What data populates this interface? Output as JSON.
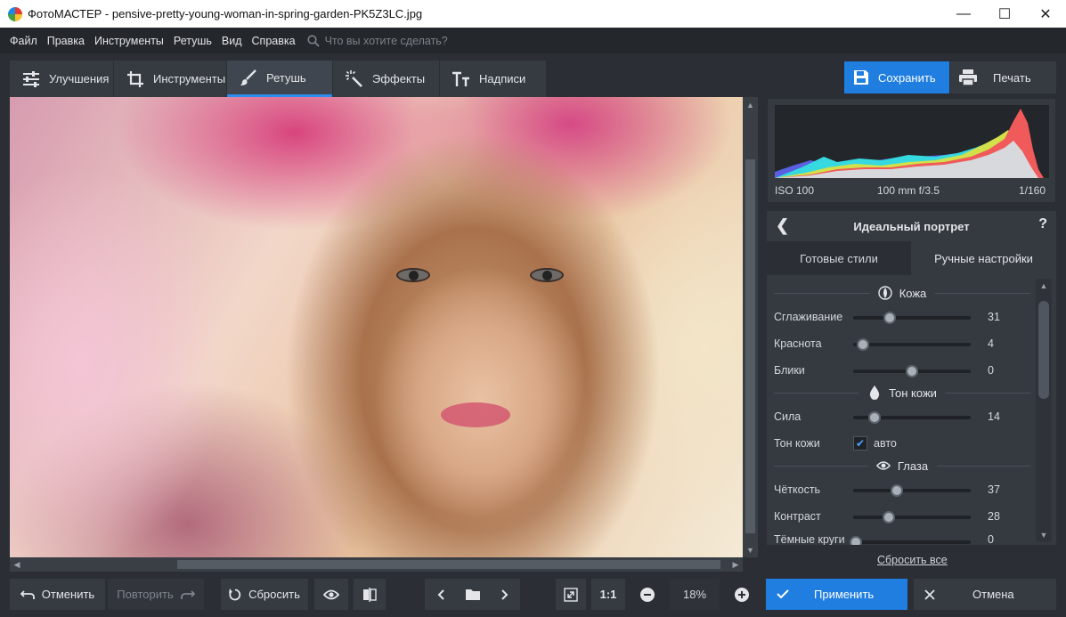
{
  "window": {
    "title": "ФотоМАСТЕР - pensive-pretty-young-woman-in-spring-garden-PK5Z3LC.jpg",
    "minimize_glyph": "—",
    "maximize_glyph": "☐",
    "close_glyph": "✕"
  },
  "menu": {
    "items": [
      "Файл",
      "Правка",
      "Инструменты",
      "Ретушь",
      "Вид",
      "Справка"
    ],
    "search_placeholder": "Что вы хотите сделать?"
  },
  "toolbar": {
    "tabs": [
      {
        "label": "Улучшения",
        "icon": "sliders-icon"
      },
      {
        "label": "Инструменты",
        "icon": "crop-icon"
      },
      {
        "label": "Ретушь",
        "icon": "brush-icon",
        "active": true
      },
      {
        "label": "Эффекты",
        "icon": "magic-wand-icon"
      },
      {
        "label": "Надписи",
        "icon": "text-icon"
      }
    ],
    "save_label": "Сохранить",
    "print_label": "Печать"
  },
  "histogram": {
    "iso": "ISO 100",
    "lens": "100 mm f/3.5",
    "shutter": "1/160"
  },
  "panel": {
    "title": "Идеальный портрет",
    "back_glyph": "❮",
    "help_glyph": "?",
    "tabs": [
      "Готовые стили",
      "Ручные настройки"
    ],
    "active_tab": "Ручные настройки",
    "sections": {
      "skin": "Кожа",
      "skin_tone": "Тон кожи",
      "eyes": "Глаза"
    },
    "sliders": {
      "smoothing": {
        "label": "Сглаживание",
        "value": "31",
        "fraction": 0.31
      },
      "redness": {
        "label": "Краснота",
        "value": "4",
        "fraction": 0.08
      },
      "highlights": {
        "label": "Блики",
        "value": "0",
        "fraction": 0.5
      },
      "strength": {
        "label": "Сила",
        "value": "14",
        "fraction": 0.18
      },
      "clarity": {
        "label": "Чёткость",
        "value": "37",
        "fraction": 0.37
      },
      "contrast": {
        "label": "Контраст",
        "value": "28",
        "fraction": 0.3
      },
      "dark_circles": {
        "label": "Тёмные круги",
        "value": "0",
        "fraction": 0.02
      }
    },
    "skin_tone_row": {
      "label": "Тон кожи",
      "checkbox_label": "авто",
      "checked": true
    },
    "reset_all": "Сбросить все"
  },
  "bottom": {
    "undo": "Отменить",
    "redo": "Повторить",
    "reset": "Сбросить",
    "one_to_one": "1:1",
    "zoom": "18%",
    "apply": "Применить",
    "cancel": "Отмена"
  },
  "colors": {
    "accent": "#1f7ee0",
    "background": "#2b2f35",
    "panel": "#353a41"
  }
}
